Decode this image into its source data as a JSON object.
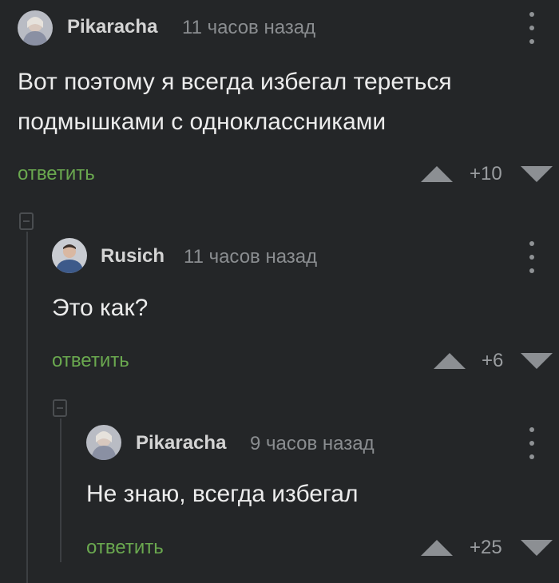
{
  "comments": [
    {
      "username": "Pikaracha",
      "time": "11 часов назад",
      "text_lines": [
        "Вот поэтому я всегда избегал тереться",
        "подмышками с одноклассниками"
      ],
      "reply_label": "ответить",
      "rating": "+10"
    },
    {
      "username": "Rusich",
      "time": "11 часов назад",
      "text_lines": [
        "Это как?"
      ],
      "reply_label": "ответить",
      "rating": "+6"
    },
    {
      "username": "Pikaracha",
      "time": "9 часов назад",
      "text_lines": [
        "Не знаю, всегда избегал"
      ],
      "reply_label": "ответить",
      "rating": "+25"
    }
  ],
  "colors": {
    "background": "#242628",
    "reply_link": "#6aa84f",
    "text": "#ececec",
    "muted": "#8a8d90"
  },
  "icons": {
    "more": "vertical-dots-icon",
    "upvote": "triangle-up-icon",
    "downvote": "triangle-down-icon",
    "collapse": "collapse-minus-icon"
  }
}
